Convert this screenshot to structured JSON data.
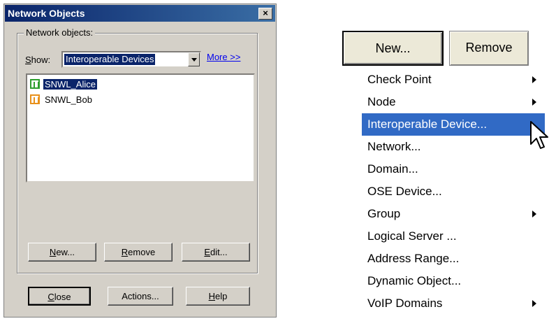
{
  "dialog": {
    "title": "Network Objects",
    "close_symbol": "×",
    "group_label": "Network objects:",
    "show_label_prefix": "S",
    "show_label_rest": "how:",
    "show_value": "Interoperable Devices",
    "more_link": "More >>",
    "list_items": [
      {
        "label": "SNWL_Alice",
        "selected": true,
        "icon_color": "#2e9e2e"
      },
      {
        "label": "SNWL_Bob",
        "selected": false,
        "icon_color": "#e8901a"
      }
    ],
    "buttons": {
      "new": {
        "u": "N",
        "rest": "ew..."
      },
      "remove": {
        "u": "R",
        "rest": "emove"
      },
      "edit": {
        "u": "E",
        "rest": "dit..."
      },
      "close": {
        "u": "C",
        "rest": "lose"
      },
      "actions": "Actions...",
      "help": {
        "u": "H",
        "rest": "elp"
      }
    }
  },
  "context": {
    "new_button": "New...",
    "remove_button": "Remove",
    "menu_items": [
      {
        "label": "Check Point",
        "submenu": true
      },
      {
        "label": "Node",
        "submenu": true
      },
      {
        "label": "Interoperable Device...",
        "submenu": false,
        "highlight": true
      },
      {
        "label": "Network...",
        "submenu": false
      },
      {
        "label": "Domain...",
        "submenu": false
      },
      {
        "label": "OSE Device...",
        "submenu": false
      },
      {
        "label": "Group",
        "submenu": true
      },
      {
        "label": "Logical Server ...",
        "submenu": false
      },
      {
        "label": "Address Range...",
        "submenu": false
      },
      {
        "label": "Dynamic Object...",
        "submenu": false
      },
      {
        "label": "VoIP Domains",
        "submenu": true
      }
    ]
  },
  "colors": {
    "title_bar": "#0a246a",
    "menu_highlight": "#316ac5",
    "link": "#0000ee"
  }
}
